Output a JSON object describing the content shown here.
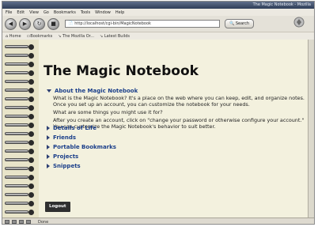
{
  "window": {
    "title": "The Magic Notebook - Mozilla"
  },
  "menu": [
    "File",
    "Edit",
    "View",
    "Go",
    "Bookmarks",
    "Tools",
    "Window",
    "Help"
  ],
  "toolbar": {
    "url": "http://localhost/cgi-bin/MagicNotebook",
    "search_label": "Search"
  },
  "bookmarks": [
    "Home",
    "Bookmarks",
    "The Mozilla Or...",
    "Latest Builds"
  ],
  "page": {
    "title": "The Magic Notebook",
    "expanded_topic": "About the Magic Notebook",
    "paragraphs": [
      "What is the Magic Notebook? It's a place on the web where you can keep, edit, and organize notes. Once you set up an account, you can customize the notebook for your needs.",
      "What are some things you might use it for?",
      "After you create an account, click on \"change your password or otherwise configure your account.\" You can customize the Magic Notebook's behavior to suit better."
    ],
    "topics": [
      "Details of Life",
      "Friends",
      "Portable Bookmarks",
      "Projects",
      "Snippets"
    ],
    "logout_label": "Logout"
  },
  "status": {
    "text": "Done"
  }
}
